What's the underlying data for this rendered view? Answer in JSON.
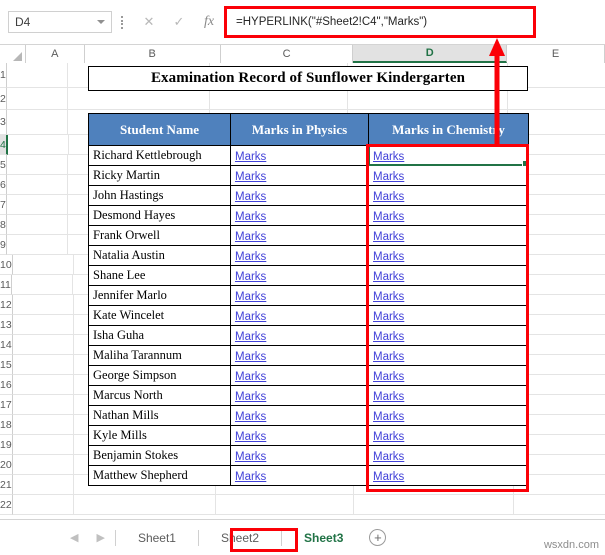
{
  "formula_bar": {
    "name_box_value": "D4",
    "formula": "=HYPERLINK(\"#Sheet2!C4\",\"Marks\")",
    "cancel_icon": "close-icon",
    "confirm_icon": "check-icon",
    "function_icon": "fx-icon"
  },
  "columns": [
    "A",
    "B",
    "C",
    "D",
    "E"
  ],
  "active_column": "D",
  "active_row": "4",
  "rows": [
    "1",
    "2",
    "3",
    "4",
    "5",
    "6",
    "7",
    "8",
    "9",
    "10",
    "11",
    "12",
    "13",
    "14",
    "15",
    "16",
    "17",
    "18",
    "19",
    "20",
    "21",
    "22"
  ],
  "sheet": {
    "title": "Examination Record of Sunflower Kindergarten",
    "headers": [
      "Student Name",
      "Marks in Physics",
      "Marks in Chemistry"
    ],
    "link_label": "Marks",
    "students": [
      "Richard Kettlebrough",
      "Ricky Martin",
      "John Hastings",
      "Desmond Hayes",
      "Frank Orwell",
      "Natalia Austin",
      "Shane Lee",
      "Jennifer Marlo",
      "Kate Wincelet",
      "Isha Guha",
      "Maliha Tarannum",
      "George Simpson",
      "Marcus North",
      "Nathan Mills",
      "Kyle Mills",
      "Benjamin Stokes",
      "Matthew Shepherd"
    ]
  },
  "tabs": {
    "items": [
      "Sheet1",
      "Sheet2",
      "Sheet3"
    ],
    "active": "Sheet3",
    "add_label": "+",
    "prev_icon": "triangle-left-icon",
    "next_icon": "triangle-right-icon"
  },
  "watermark": "wsxdn.com",
  "colors": {
    "header_blue": "#4F81BD",
    "link_blue": "#4141D8",
    "excel_green": "#217346",
    "annotation_red": "#FB0007"
  }
}
